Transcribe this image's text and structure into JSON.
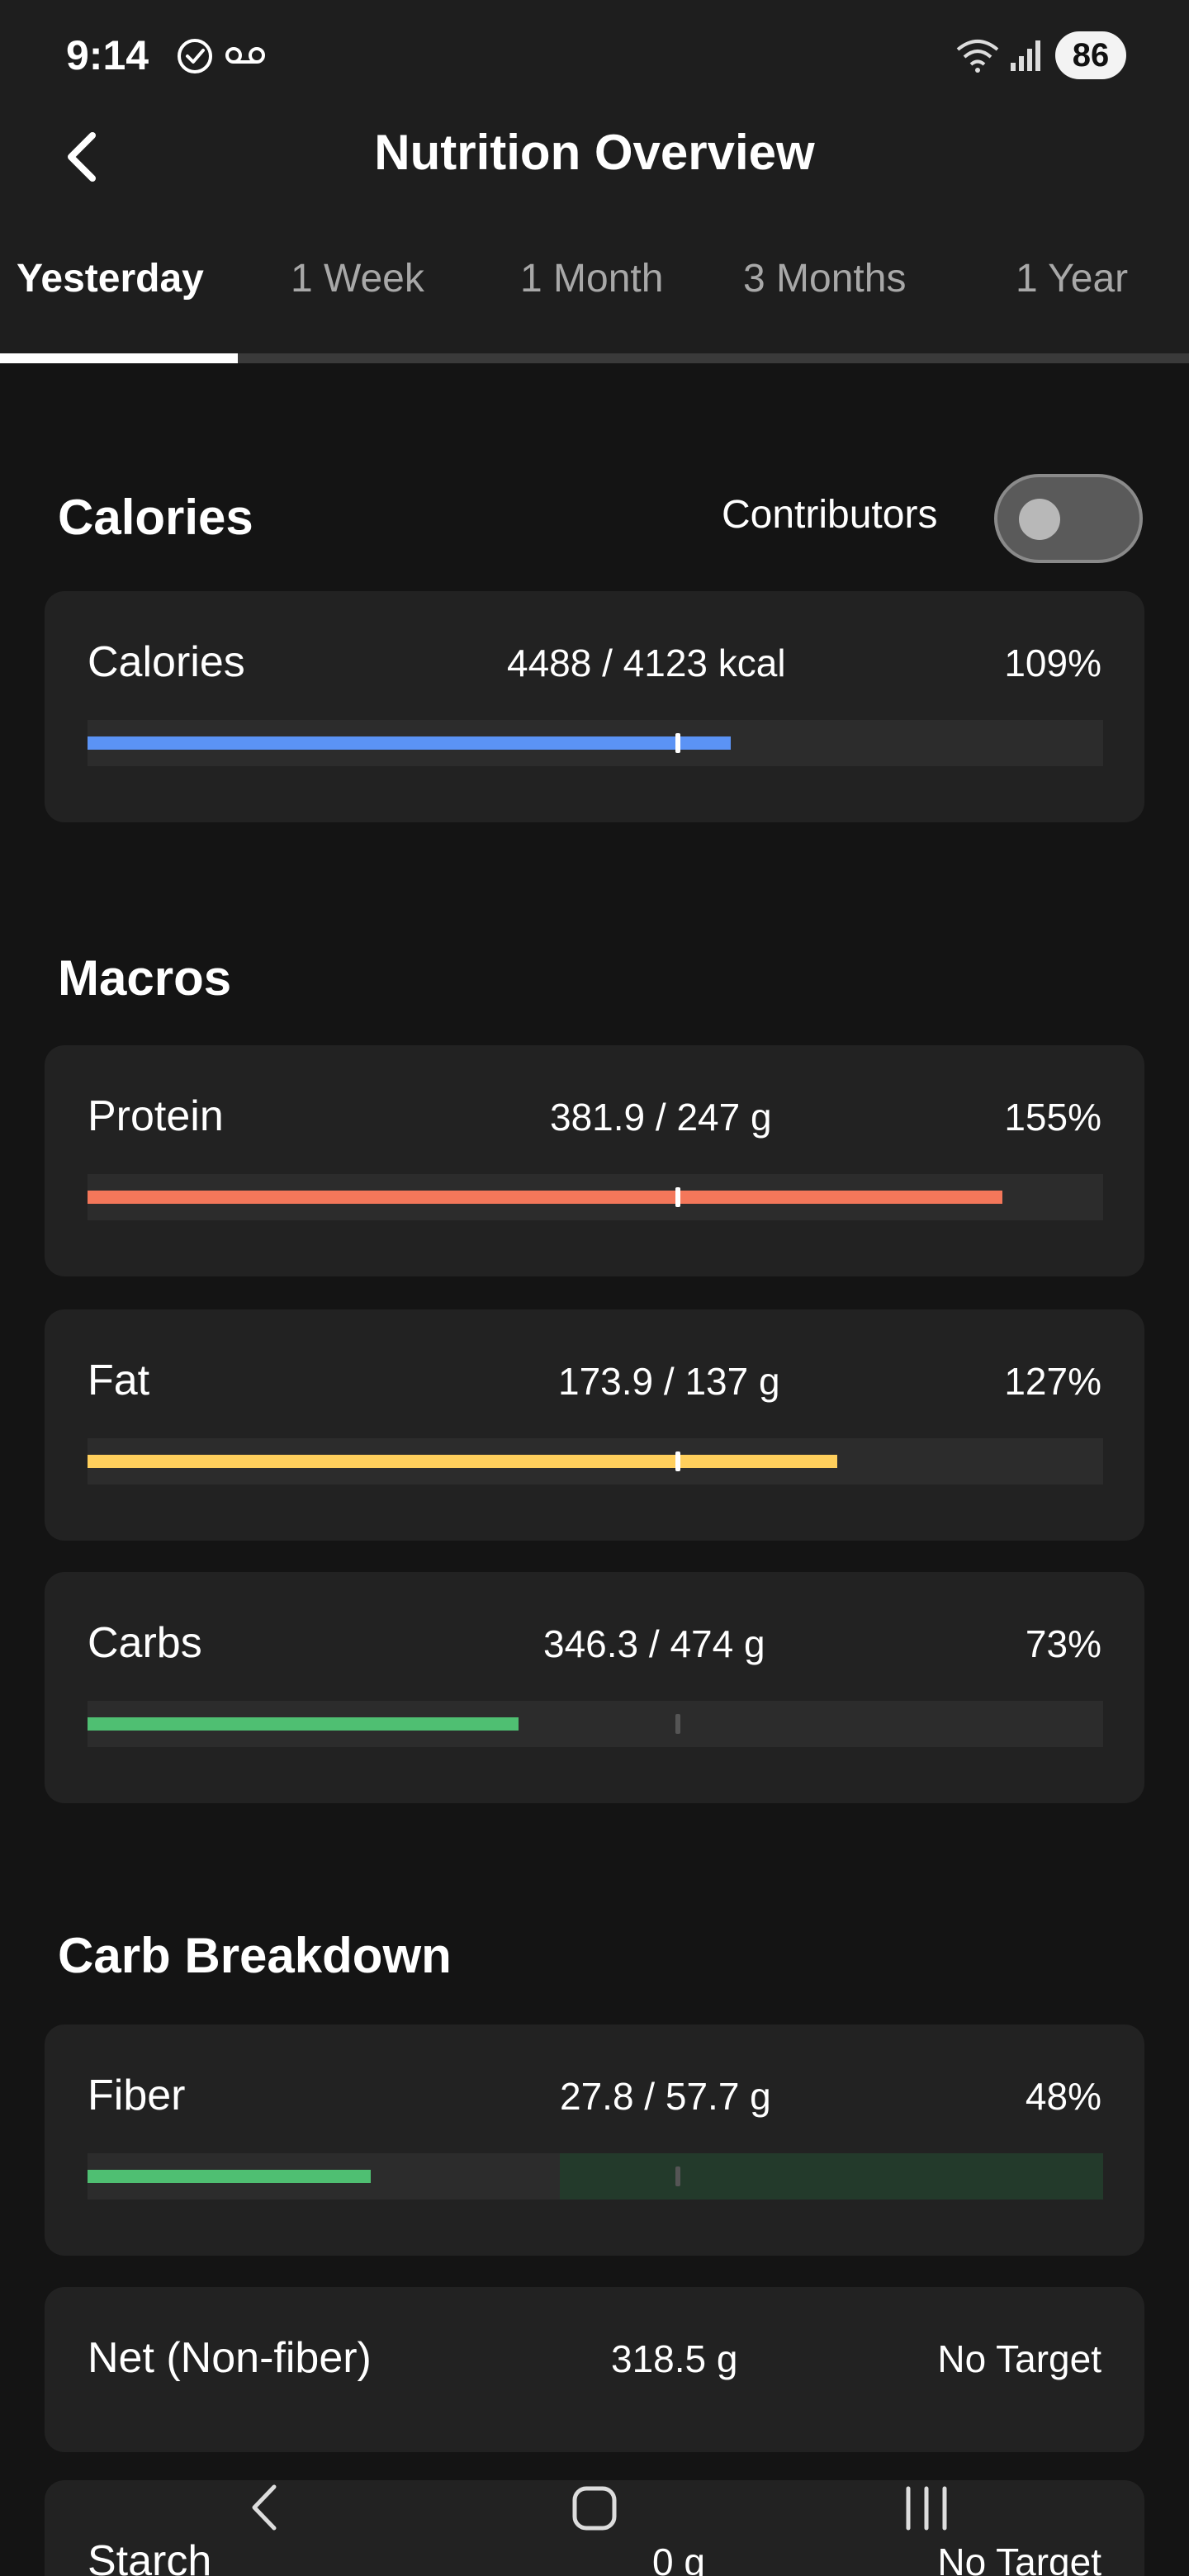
{
  "status_bar": {
    "time": "9:14",
    "battery": "86"
  },
  "header": {
    "title": "Nutrition Overview"
  },
  "tabs": [
    "Yesterday",
    "1 Week",
    "1 Month",
    "3 Months",
    "1 Year"
  ],
  "calories": {
    "section_title": "Calories",
    "contributors_label": "Contributors",
    "contributors_enabled": false,
    "card": {
      "label": "Calories",
      "amount": "4488 / 4123 kcal",
      "percent": "109%",
      "progress": 1.09,
      "color": "#5b93f5"
    }
  },
  "macros": {
    "section_title": "Macros",
    "items": [
      {
        "label": "Protein",
        "amount": "381.9 / 247 g",
        "percent": "155%",
        "progress": 1.55,
        "color": "#f4775a"
      },
      {
        "label": "Fat",
        "amount": "173.9 / 137 g",
        "percent": "127%",
        "progress": 1.27,
        "color": "#ffcf5c"
      },
      {
        "label": "Carbs",
        "amount": "346.3 / 474 g",
        "percent": "73%",
        "progress": 0.73,
        "color": "#4fbf72"
      }
    ]
  },
  "carb_breakdown": {
    "section_title": "Carb Breakdown",
    "fiber": {
      "label": "Fiber",
      "amount": "27.8 / 57.7 g",
      "percent": "48%",
      "progress": 0.48,
      "color": "#4fbf72"
    },
    "net": {
      "label": "Net (Non-fiber)",
      "amount": "318.5 g",
      "target": "No Target"
    },
    "starch": {
      "label": "Starch",
      "amount": "0 g",
      "target": "No Target"
    }
  }
}
